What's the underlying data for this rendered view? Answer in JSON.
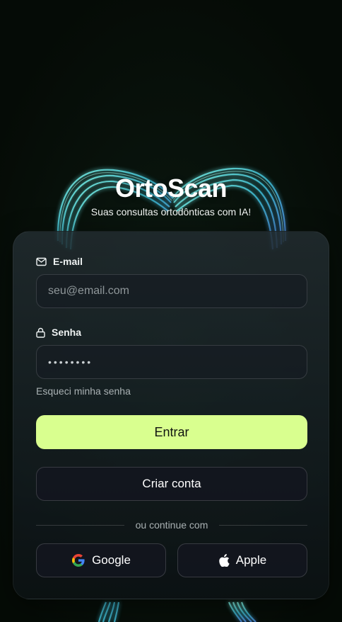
{
  "brand": {
    "title": "OrtoScan",
    "subtitle": "Suas consultas ortodônticas com IA!"
  },
  "form": {
    "email": {
      "label": "E-mail",
      "placeholder": "seu@email.com",
      "icon": "mail-icon"
    },
    "password": {
      "label": "Senha",
      "value": "••••••••",
      "icon": "lock-icon"
    },
    "forgot_label": "Esqueci minha senha",
    "submit_label": "Entrar",
    "create_account_label": "Criar conta",
    "divider_text": "ou continue com",
    "google_label": "Google",
    "apple_label": "Apple"
  },
  "colors": {
    "background": "#071008",
    "accent": "#d9ff8f",
    "tooth_glow": "#4fd6c8"
  }
}
